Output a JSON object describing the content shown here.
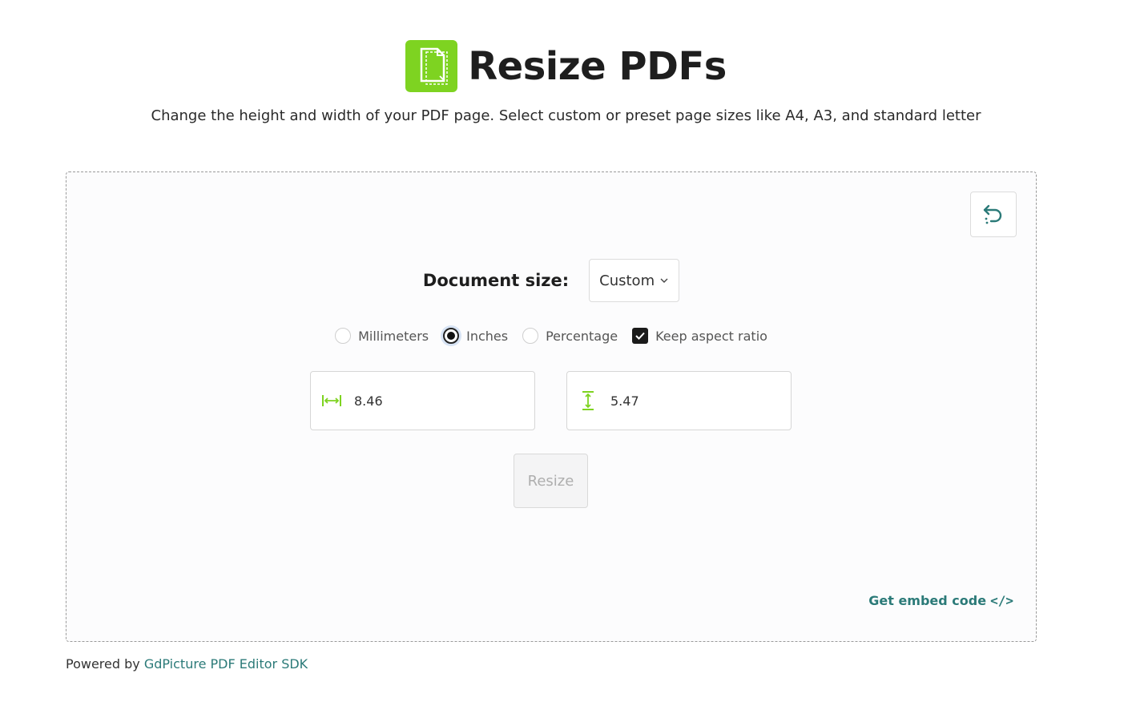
{
  "header": {
    "title": "Resize PDFs",
    "subtitle": "Change the height and width of your PDF page. Select custom or preset page sizes like A4, A3, and standard letter"
  },
  "colors": {
    "brand_green": "#7ed321",
    "link_teal": "#2b7a78"
  },
  "form": {
    "document_size_label": "Document size:",
    "document_size_value": "Custom",
    "units": [
      {
        "label": "Millimeters",
        "checked": false
      },
      {
        "label": "Inches",
        "checked": true
      },
      {
        "label": "Percentage",
        "checked": false
      }
    ],
    "keep_aspect_label": "Keep aspect ratio",
    "keep_aspect_checked": true,
    "width_value": "8.46",
    "height_value": "5.47",
    "resize_label": "Resize",
    "reset_icon": "undo-icon"
  },
  "embed": {
    "label": "Get embed code",
    "icon": "</>"
  },
  "footer": {
    "prefix": "Powered by ",
    "link_text": "GdPicture PDF Editor SDK"
  }
}
